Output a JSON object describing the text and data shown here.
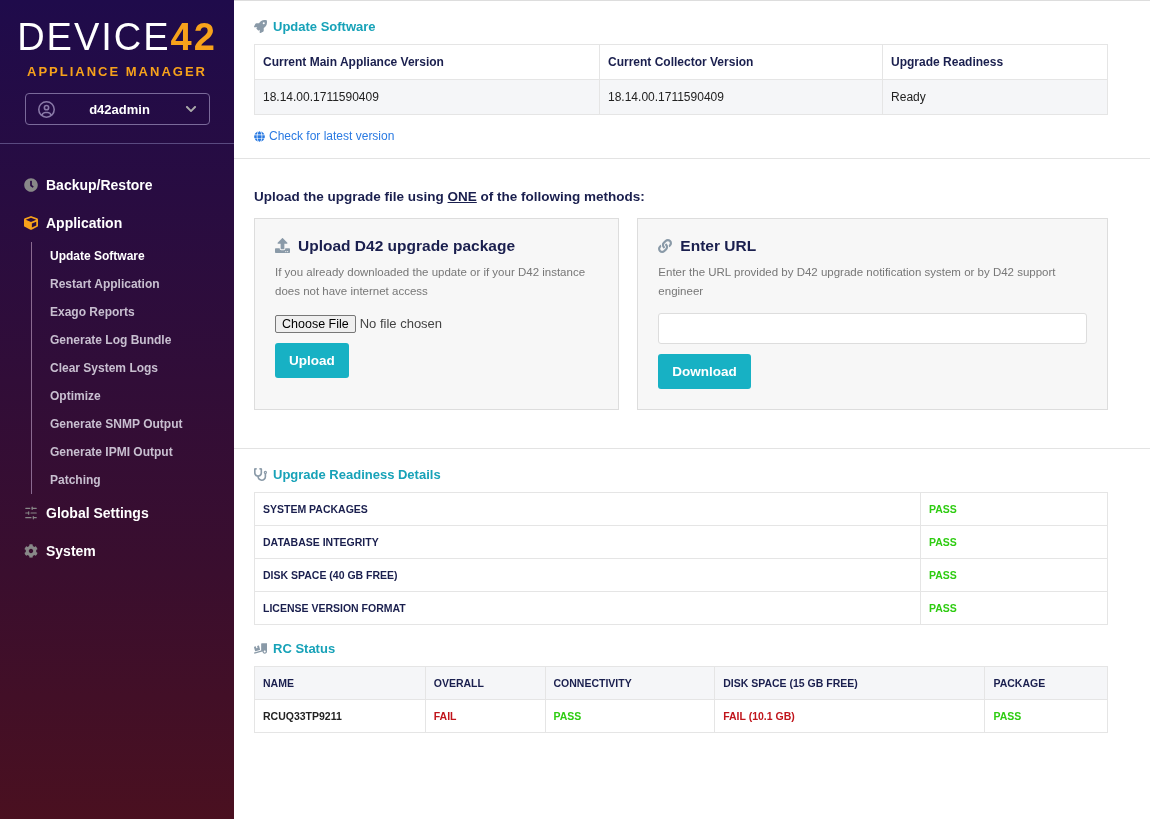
{
  "sidebar": {
    "logo": {
      "word": "DEVICE",
      "number": "42",
      "subtitle": "APPLIANCE MANAGER"
    },
    "user": {
      "name": "d42admin"
    },
    "items": [
      {
        "label": "Backup/Restore",
        "expanded": false
      },
      {
        "label": "Application",
        "expanded": true,
        "children": [
          {
            "label": "Update Software",
            "selected": true
          },
          {
            "label": "Restart Application",
            "selected": false
          },
          {
            "label": "Exago Reports",
            "selected": false
          },
          {
            "label": "Generate Log Bundle",
            "selected": false
          },
          {
            "label": "Clear System Logs",
            "selected": false
          },
          {
            "label": "Optimize",
            "selected": false
          },
          {
            "label": "Generate SNMP Output",
            "selected": false
          },
          {
            "label": "Generate IPMI Output",
            "selected": false
          },
          {
            "label": "Patching",
            "selected": false
          }
        ]
      },
      {
        "label": "Global Settings",
        "expanded": false
      },
      {
        "label": "System",
        "expanded": false
      }
    ]
  },
  "update_software": {
    "title": "Update Software",
    "columns": [
      "Current Main Appliance Version",
      "Current Collector Version",
      "Upgrade Readiness"
    ],
    "row": [
      "18.14.00.1711590409",
      "18.14.00.1711590409",
      "Ready"
    ],
    "link": "Check for latest version"
  },
  "upload": {
    "heading": {
      "before": "Upload the upgrade file using",
      "emphasis": "ONE",
      "after": "of the following methods:"
    },
    "methods": [
      {
        "kind": "file",
        "title": "Upload D42 upgrade package",
        "description": "If you already downloaded the update or if your D42 instance does not have internet access",
        "file_button": "Choose File",
        "file_status": "No file chosen",
        "button": "Upload"
      },
      {
        "kind": "url",
        "title": "Enter URL",
        "description": "Enter the URL provided by D42 upgrade notification system or by D42 support engineer",
        "button": "Download"
      }
    ]
  },
  "readiness": {
    "title": "Upgrade Readiness Details",
    "rows": [
      {
        "name": "SYSTEM PACKAGES",
        "result": "PASS",
        "color": "#2ecc11"
      },
      {
        "name": "DATABASE INTEGRITY",
        "result": "PASS",
        "color": "#2ecc11"
      },
      {
        "name": "DISK SPACE (40 GB FREE)",
        "result": "PASS",
        "color": "#2ecc11"
      },
      {
        "name": "LICENSE VERSION FORMAT",
        "result": "PASS",
        "color": "#2ecc11"
      }
    ]
  },
  "rc_status": {
    "title": "RC Status",
    "columns": [
      "NAME",
      "OVERALL",
      "CONNECTIVITY",
      "DISK SPACE (15 GB FREE)",
      "PACKAGE"
    ],
    "rows": [
      {
        "cells": [
          {
            "text": "RCUQ33TP9211"
          },
          {
            "text": "FAIL",
            "color": "#c0141b"
          },
          {
            "text": "PASS",
            "color": "#2ecc11"
          },
          {
            "text": "FAIL (10.1 GB)",
            "color": "#c0141b"
          },
          {
            "text": "PASS",
            "color": "#2ecc11"
          }
        ]
      }
    ]
  }
}
